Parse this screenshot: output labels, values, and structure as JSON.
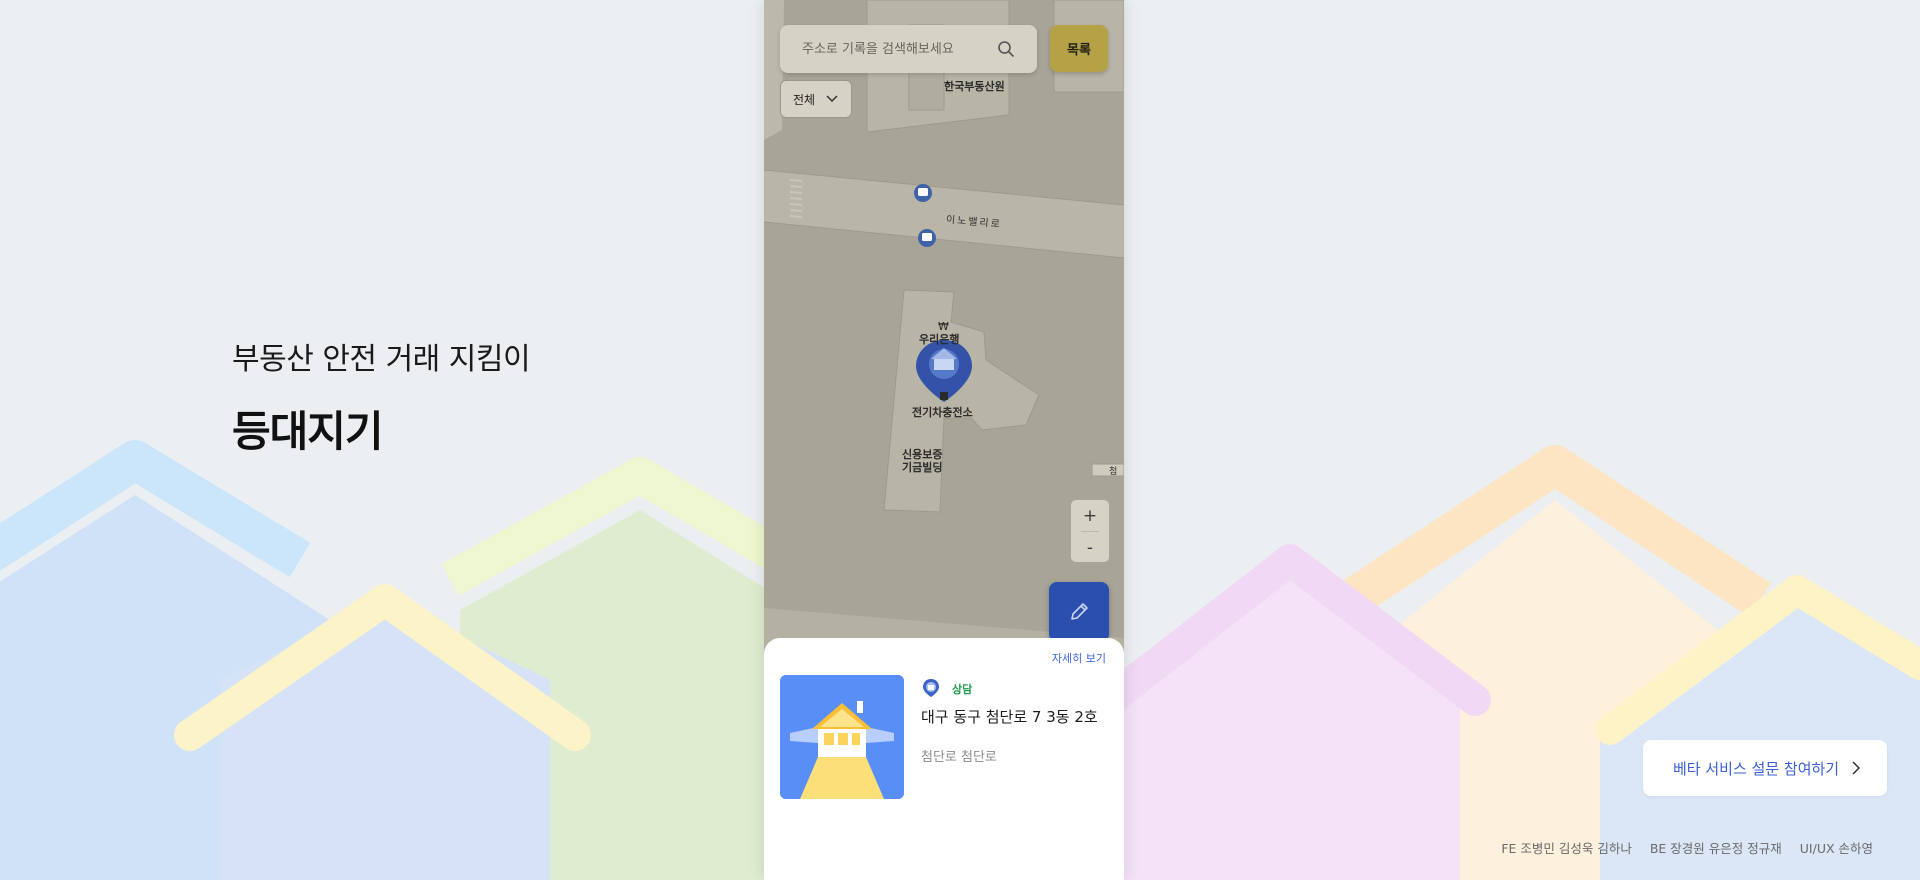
{
  "hero": {
    "subtitle": "부동산 안전 거래 지킴이",
    "title": "등대지기"
  },
  "map": {
    "search_placeholder": "주소로 기록을 검색해보세요",
    "list_button": "목록",
    "filter_value": "전체",
    "zoom_in": "+",
    "zoom_out": "-",
    "labels": {
      "building_1": "한국부동산원",
      "road": "이노밸리로",
      "bank": "우리은행",
      "charger": "전기차충전소",
      "credit_line1": "신용보증",
      "credit_line2": "기금빌딩",
      "edge": "첨"
    }
  },
  "card": {
    "detail_link": "자세히 보기",
    "status": "상담",
    "address": "대구 동구 첨단로 7 3동 2호",
    "street": "첨단로 첨단로"
  },
  "survey_button": "베타 서비스 설문 참여하기",
  "credits": {
    "fe": "FE 조병민 김성욱 김하나",
    "be": "BE 장경원 유은정 정규재",
    "uiux": "UI/UX 손하영"
  },
  "colors": {
    "accent_blue": "#3b5fd6",
    "fab_blue": "#2a4faf",
    "list_button_yellow": "#b5a247",
    "status_green": "#1f9d4d"
  }
}
